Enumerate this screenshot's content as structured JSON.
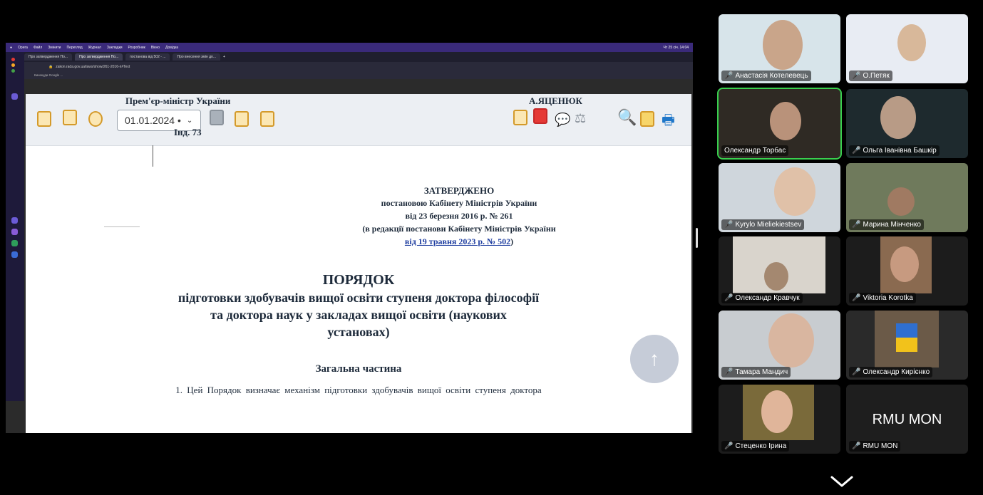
{
  "shared_screen": {
    "menubar": [
      "Opera",
      "Файл",
      "Змінити",
      "Перегляд",
      "Журнал",
      "Закладки",
      "Розробник",
      "Вікно",
      "Довідка"
    ],
    "menubar_status": "Чт 25 січ. 14:04",
    "tabs": [
      "Про затвердження По...",
      "Про затвердження По...",
      "постанова від 502 - ...",
      "Про внесення змін до..."
    ],
    "address": "zakon.rada.gov.ua/laws/show/261-2016-п#Text",
    "bookmark": "Кинокуди Google ...",
    "toolbar": {
      "date_value": "01.01.2024 •",
      "signature_left": "Прем'єр-міністр України",
      "signature_right": "А.ЯЦЕНЮК",
      "index": "Інд. 73"
    },
    "document": {
      "approved": "ЗАТВЕРДЖЕНО",
      "approved_line1": "постановою Кабінету Міністрів України",
      "approved_line2": "від 23 березня 2016 р. № 261",
      "approved_line3": "(в редакції постанови Кабінету Міністрів України",
      "approved_link": "від 19 травня 2023 р. № 502",
      "approved_close": ")",
      "title": "ПОРЯДОК",
      "subtitle1": "підготовки здобувачів вищої освіти ступеня доктора філософії",
      "subtitle2": "та доктора наук у закладах вищої освіти (наукових",
      "subtitle3": "установах)",
      "section": "Загальна частина",
      "paragraph": "1. Цей Порядок визначає механізм підготовки здобувачів вищої освіти ступеня доктора"
    },
    "calendar_day": "25"
  },
  "participants": [
    {
      "name": "Анастасія Котелевець",
      "muted": true
    },
    {
      "name": "О.Петяк",
      "muted": true
    },
    {
      "name": "Олександр Торбас",
      "muted": false
    },
    {
      "name": "Ольга Іванівна Башкір",
      "muted": true
    },
    {
      "name": "Kyrylo Mieliekiestsev",
      "muted": true
    },
    {
      "name": "Марина Мінченко",
      "muted": true
    },
    {
      "name": "Олександр Кравчук",
      "muted": true
    },
    {
      "name": "Viktoria Korotka",
      "muted": true
    },
    {
      "name": "Тамара Мандич",
      "muted": true
    },
    {
      "name": "Олександр Кирієнко",
      "muted": true
    },
    {
      "name": "Стеценко Ірина",
      "muted": true
    },
    {
      "name": "RMU MON",
      "muted": true
    }
  ],
  "rmu_label": "RMU MON",
  "colors": {
    "active_speaker": "#3ad04f",
    "mute": "#e53935",
    "link": "#1f3ea0"
  }
}
